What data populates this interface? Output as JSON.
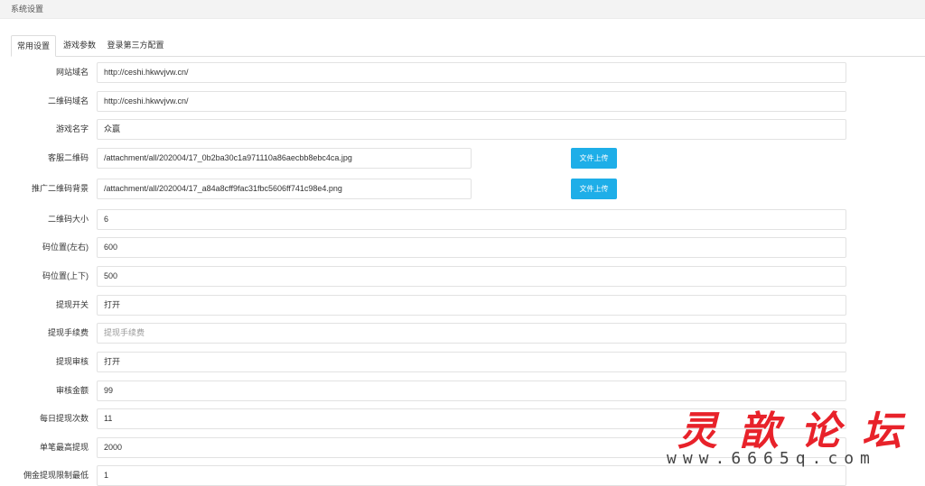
{
  "header": {
    "title": "系统设置"
  },
  "tabs": [
    {
      "label": "常用设置",
      "active": true
    },
    {
      "label": "游戏参数",
      "active": false
    },
    {
      "label": "登录第三方配置",
      "active": false
    }
  ],
  "form": {
    "site_domain": {
      "label": "网站域名",
      "value": "http://ceshi.hkwvjvw.cn/"
    },
    "qr_domain": {
      "label": "二维码域名",
      "value": "http://ceshi.hkwvjvw.cn/"
    },
    "game_name": {
      "label": "游戏名字",
      "value": "众赢"
    },
    "service_qr": {
      "label": "客服二维码",
      "value": "/attachment/all/202004/17_0b2ba30c1a971110a86aecbb8ebc4ca.jpg",
      "button": "文件上传"
    },
    "promo_qr_bg": {
      "label": "推广二维码背景",
      "value": "/attachment/all/202004/17_a84a8cff9fac31fbc5606ff741c98e4.png",
      "button": "文件上传"
    },
    "qr_size": {
      "label": "二维码大小",
      "value": "6"
    },
    "code_pos_lr": {
      "label": "码位置(左右)",
      "value": "600"
    },
    "code_pos_tb": {
      "label": "码位置(上下)",
      "value": "500"
    },
    "withdraw_switch": {
      "label": "提现开关",
      "value": "打开"
    },
    "withdraw_fee": {
      "label": "提现手续费",
      "placeholder": "提现手续费"
    },
    "withdraw_review": {
      "label": "提现审核",
      "value": "打开"
    },
    "review_amount": {
      "label": "审核金额",
      "value": "99"
    },
    "daily_withdraw_times": {
      "label": "每日提现次数",
      "value": "11"
    },
    "single_max_withdraw": {
      "label": "单笔最高提现",
      "value": "2000"
    },
    "commission_min_withdraw": {
      "label": "佣金提现限制最低",
      "value": "1"
    }
  },
  "watermark": {
    "text": "灵歆论坛",
    "url": "www.6665q.com"
  },
  "colors": {
    "accent": "#1eaee8",
    "watermark": "#e8222a"
  }
}
